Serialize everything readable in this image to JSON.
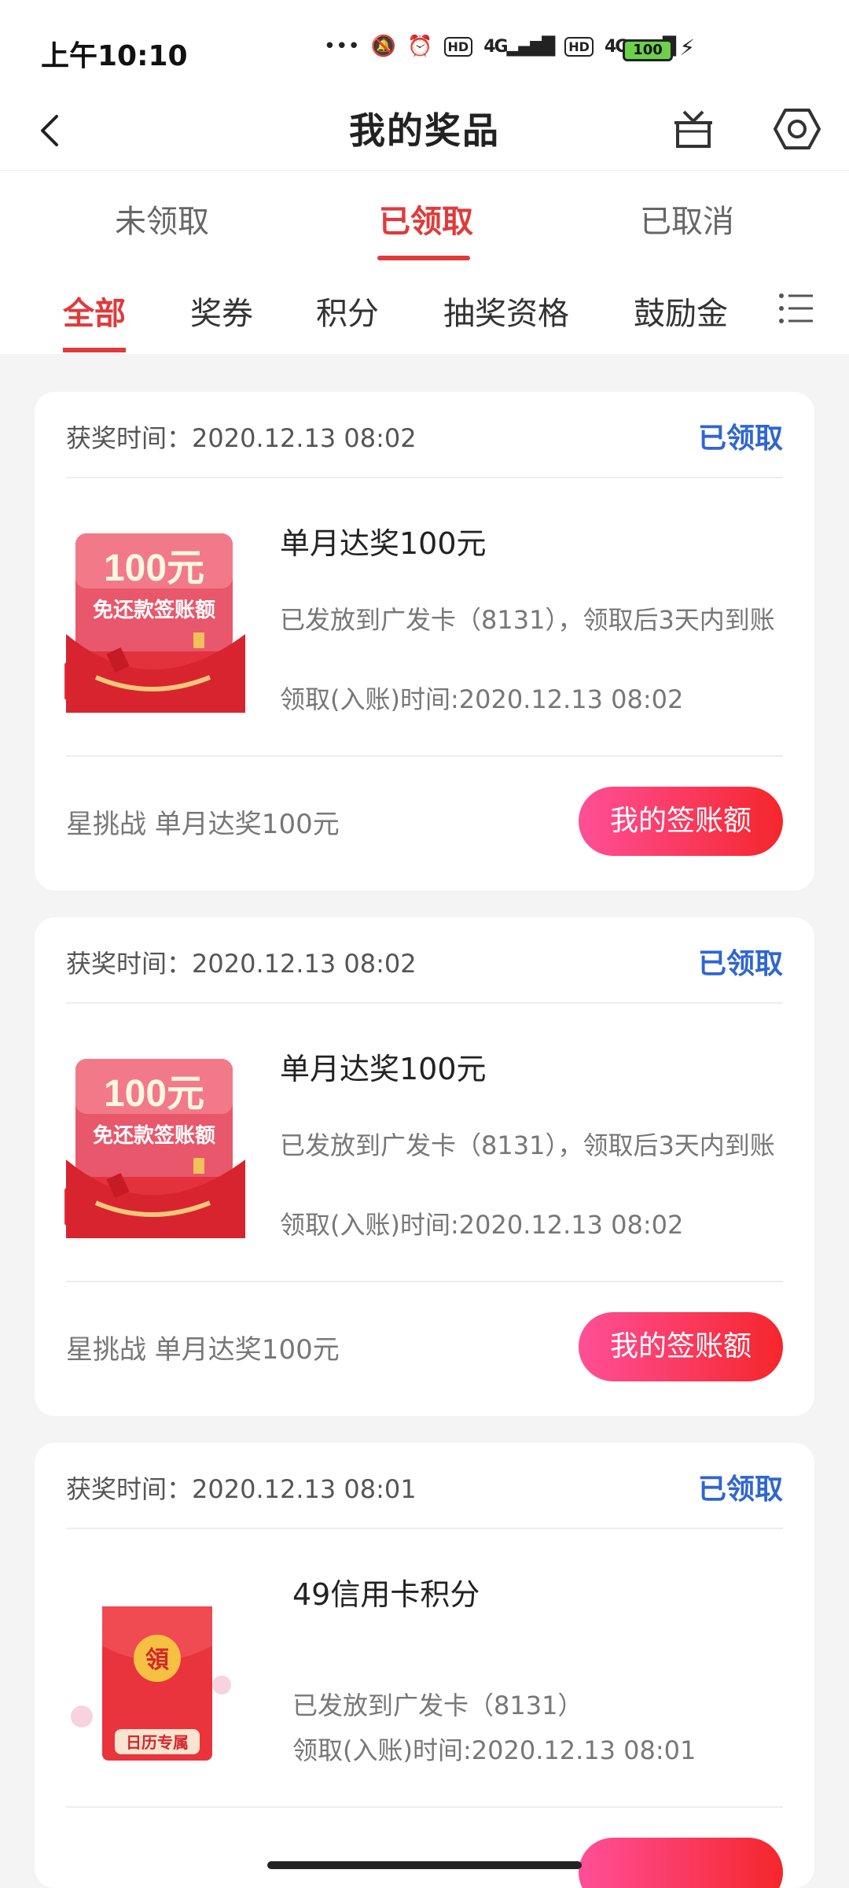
{
  "status_bar": {
    "time": "上午10:10",
    "signal_1": "4G",
    "signal_2": "4G",
    "hd_1": "HD",
    "hd_2": "HD",
    "battery": "100"
  },
  "header": {
    "title": "我的奖品",
    "icons": [
      "back-icon",
      "gift-icon",
      "settings-icon"
    ]
  },
  "tabs": [
    {
      "label": "未领取",
      "active": false
    },
    {
      "label": "已领取",
      "active": true
    },
    {
      "label": "已取消",
      "active": false
    }
  ],
  "subtabs": [
    {
      "label": "全部",
      "active": true
    },
    {
      "label": "奖券",
      "active": false
    },
    {
      "label": "积分",
      "active": false
    },
    {
      "label": "抽奖资格",
      "active": false
    },
    {
      "label": "鼓励金",
      "active": false
    }
  ],
  "cards": [
    {
      "win_time": "获奖时间：2020.12.13 08:02",
      "status": "已领取",
      "thumb_amount": "100元",
      "thumb_caption": "免还款签账额",
      "title": "单月达奖100元",
      "desc": "已发放到广发卡（8131），领取后3天内到账",
      "claim_time": "领取(入账)时间:2020.12.13 08:02",
      "activity": "星挑战 单月达奖100元",
      "button": "我的签账额"
    },
    {
      "win_time": "获奖时间：2020.12.13 08:02",
      "status": "已领取",
      "thumb_amount": "100元",
      "thumb_caption": "免还款签账额",
      "title": "单月达奖100元",
      "desc": "已发放到广发卡（8131），领取后3天内到账",
      "claim_time": "领取(入账)时间:2020.12.13 08:02",
      "activity": "星挑战 单月达奖100元",
      "button": "我的签账额"
    },
    {
      "win_time": "获奖时间：2020.12.13 08:01",
      "status": "已领取",
      "thumb_badge": "領",
      "thumb_caption": "日历专属",
      "title": "49信用卡积分",
      "desc": "已发放到广发卡（8131）",
      "claim_time": "领取(入账)时间:2020.12.13 08:01"
    }
  ],
  "colors": {
    "accent_red": "#e03a3a",
    "status_blue": "#2f66d0",
    "button_gradient": [
      "#ff4f98",
      "#f5262b"
    ]
  }
}
